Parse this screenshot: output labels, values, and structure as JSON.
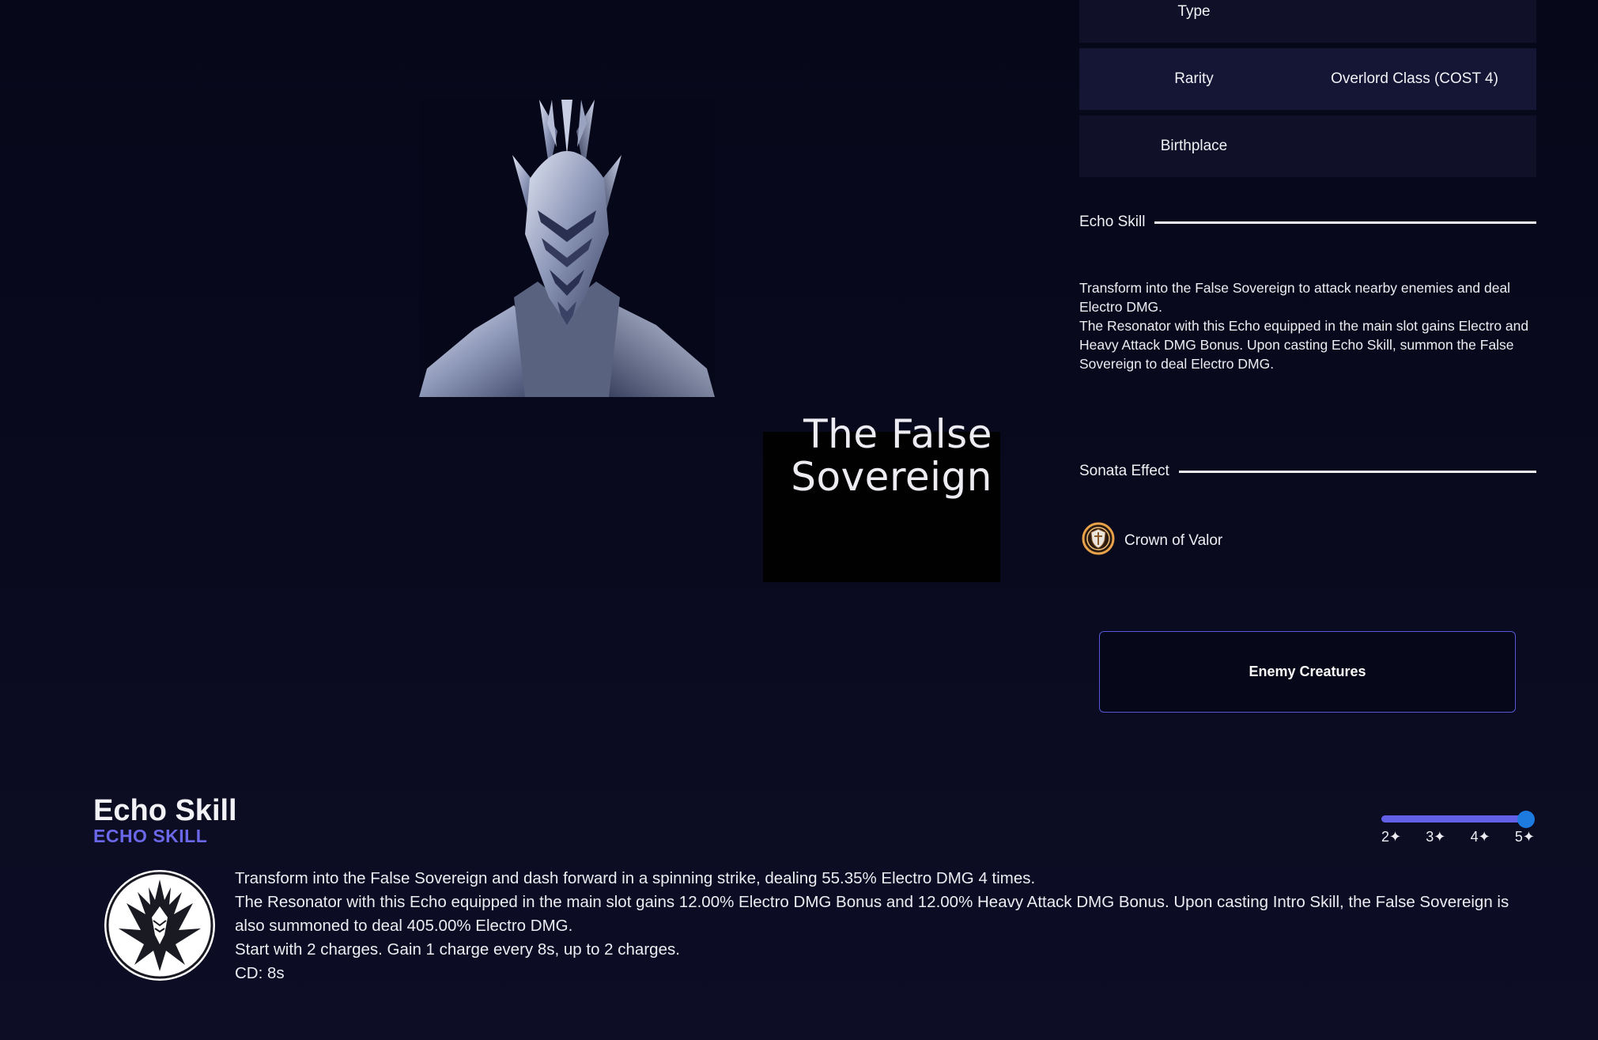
{
  "echo": {
    "name": "The False Sovereign"
  },
  "info": {
    "type_label": "Type",
    "type_value": "",
    "rarity_label": "Rarity",
    "rarity_value": "Overlord Class (COST 4)",
    "birthplace_label": "Birthplace",
    "birthplace_value": ""
  },
  "echo_skill_section": {
    "heading": "Echo Skill",
    "desc_1": "Transform into the False Sovereign to attack nearby enemies and deal Electro DMG.",
    "desc_2": "The Resonator with this Echo equipped in the main slot gains Electro and Heavy Attack DMG Bonus. Upon casting Echo Skill, summon the False Sovereign to deal Electro DMG."
  },
  "sonata_section": {
    "heading": "Sonata Effect",
    "item_label": "Crown of Valor",
    "item_icon": "crown-of-valor-icon"
  },
  "enemy_button": {
    "label": "Enemy Creatures"
  },
  "bottom": {
    "title": "Echo Skill",
    "subtitle": "ECHO SKILL",
    "icon": "false-sovereign-skill-icon",
    "rarity_slider": {
      "ticks": [
        "2✦",
        "3✦",
        "4✦",
        "5✦"
      ],
      "selected": "5✦"
    },
    "lines": [
      "Transform into the False Sovereign and dash forward in a spinning strike, dealing 55.35% Electro DMG 4 times.",
      "The Resonator with this Echo equipped in the main slot gains 12.00% Electro DMG Bonus and 12.00% Heavy Attack DMG Bonus. Upon casting Intro Skill, the False Sovereign is also summoned to deal 405.00% Electro DMG.",
      "Start with 2 charges. Gain 1 charge every 8s, up to 2 charges.",
      "CD: 8s"
    ]
  },
  "colors": {
    "background": "#07071a",
    "row_dark": "#101028",
    "row_light": "#151535",
    "accent": "#6a68e8",
    "slider_thumb": "#1d7be0",
    "button_border": "#5558d8"
  }
}
